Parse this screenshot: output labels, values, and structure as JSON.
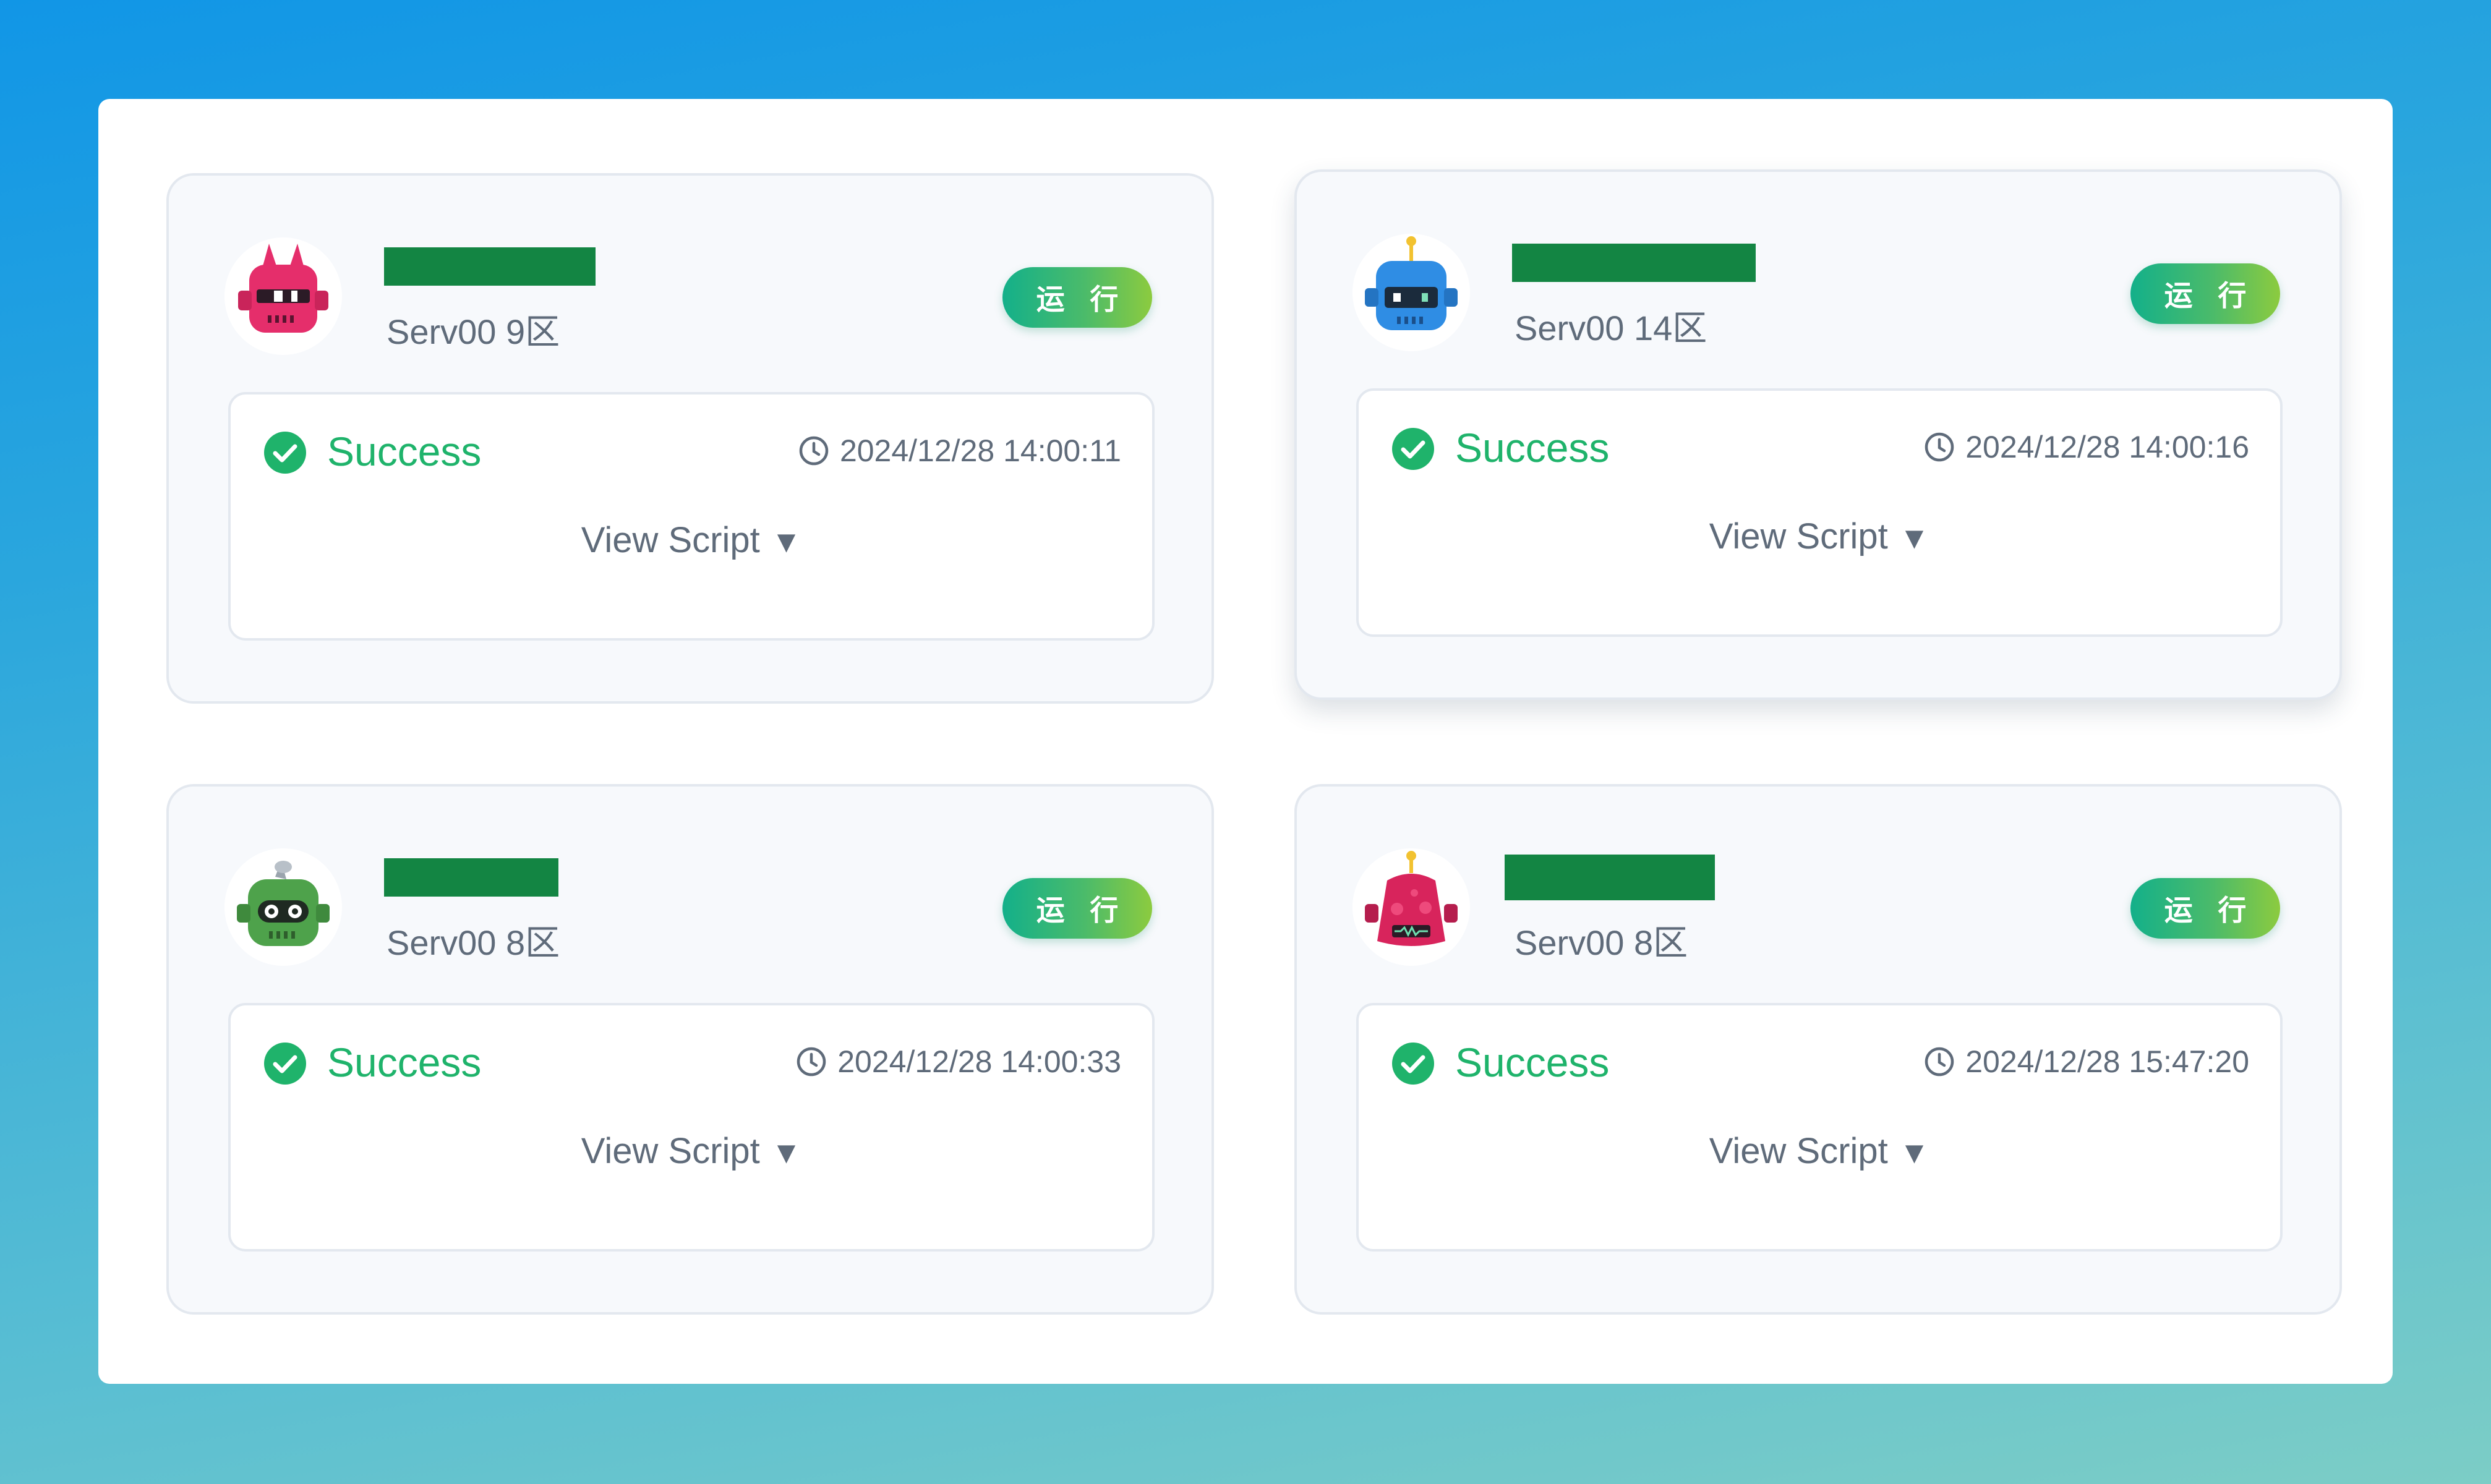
{
  "cards": [
    {
      "server": "Serv00 9区",
      "run_label": "运 行",
      "status": "Success",
      "timestamp": "2024/12/28 14:00:11",
      "view_script": "View Script",
      "avatar": "robot-avatar-red-horned"
    },
    {
      "server": "Serv00 14区",
      "run_label": "运 行",
      "status": "Success",
      "timestamp": "2024/12/28 14:00:16",
      "view_script": "View Script",
      "avatar": "robot-avatar-blue"
    },
    {
      "server": "Serv00 8区",
      "run_label": "运 行",
      "status": "Success",
      "timestamp": "2024/12/28 14:00:33",
      "view_script": "View Script",
      "avatar": "robot-avatar-green"
    },
    {
      "server": "Serv00 8区",
      "run_label": "运 行",
      "status": "Success",
      "timestamp": "2024/12/28 15:47:20",
      "view_script": "View Script",
      "avatar": "robot-avatar-red"
    }
  ],
  "icons": {
    "status": "check-circle-icon",
    "time": "clock-icon",
    "expand": "caret-down-icon",
    "caret_glyph": "▼"
  },
  "colors": {
    "success": "#1fb36b",
    "run_button_start": "#13b08a",
    "run_button_end": "#8ccb3f",
    "redaction": "#138543"
  }
}
